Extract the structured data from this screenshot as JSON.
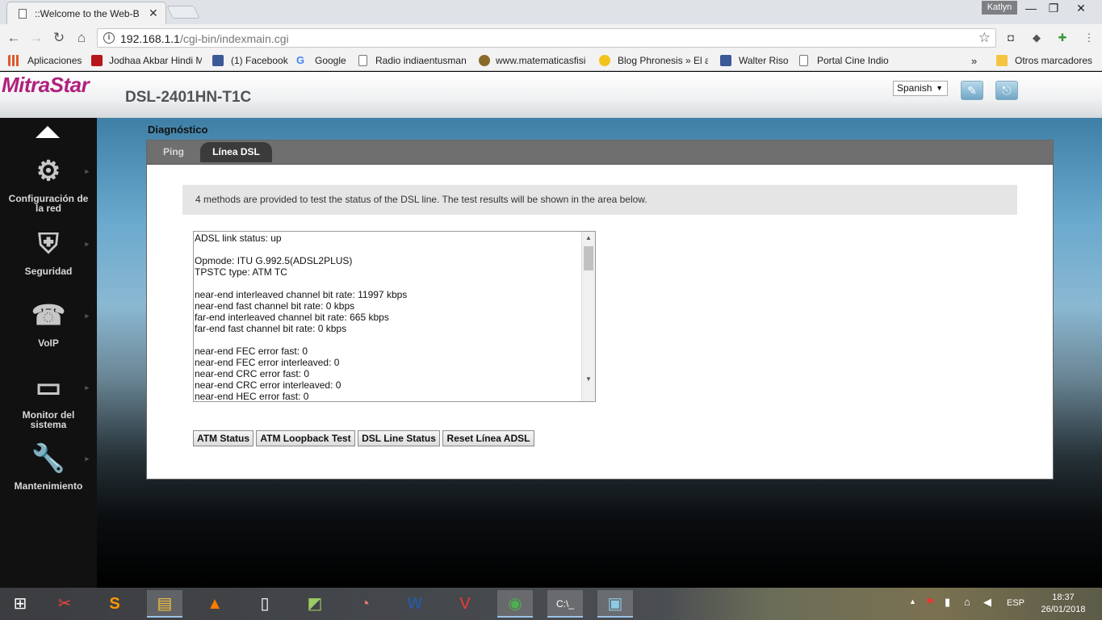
{
  "browser": {
    "tab_title": "::Welcome to the Web-B",
    "user": "Katlyn",
    "url_host": "192.168.1.1",
    "url_path": "/cgi-bin/indexmain.cgi",
    "bookmarks": [
      {
        "label": "Aplicaciones",
        "icon": "apps-grid-icon",
        "color": "#e05a2b"
      },
      {
        "label": "Jodhaa Akbar Hindi M",
        "icon": "site-icon",
        "color": "#b5171d"
      },
      {
        "label": "(1) Facebook",
        "icon": "facebook-icon",
        "color": "#3b5998"
      },
      {
        "label": "Google",
        "icon": "google-icon",
        "color": "#4285f4"
      },
      {
        "label": "Radio indiaentusmano",
        "icon": "page-icon",
        "color": "#ffffff"
      },
      {
        "label": "www.matematicasfisic",
        "icon": "site-icon",
        "color": "#8a6a2a"
      },
      {
        "label": "Blog Phronesis » El ar",
        "icon": "emoji-icon",
        "color": "#f3c21b"
      },
      {
        "label": "Walter Riso",
        "icon": "facebook-icon",
        "color": "#3b5998"
      },
      {
        "label": "Portal Cine Indio",
        "icon": "page-icon",
        "color": "#ffffff"
      }
    ],
    "bookmarks_more": "»",
    "other_bookmarks": "Otros marcadores"
  },
  "router": {
    "brand": "MitraStar",
    "model": "DSL-2401HN-T1C",
    "language": "Spanish",
    "brand_color": "#b0207d"
  },
  "sidebar": {
    "items": [
      {
        "label": "Configuración de la red",
        "icon": "gears-icon"
      },
      {
        "label": "Seguridad",
        "icon": "shield-firewall-icon"
      },
      {
        "label": "VoIP",
        "icon": "phone-icon"
      },
      {
        "label": "Monitor del sistema",
        "icon": "monitor-icon"
      },
      {
        "label": "Mantenimiento",
        "icon": "wrench-icon"
      }
    ]
  },
  "main": {
    "section_title": "Diagnóstico",
    "tabs": [
      "Ping",
      "Línea DSL"
    ],
    "info_text": "4 methods are provided to test the status of the DSL line. The test results will be shown in the area below.",
    "log_text": "ADSL link status: up\n\nOpmode: ITU G.992.5(ADSL2PLUS)\nTPSTC type: ATM TC\n\nnear-end interleaved channel bit rate: 11997 kbps\nnear-end fast channel bit rate: 0 kbps\nfar-end interleaved channel bit rate: 665 kbps\nfar-end fast channel bit rate: 0 kbps\n\nnear-end FEC error fast: 0\nnear-end FEC error interleaved: 0\nnear-end CRC error fast: 0\nnear-end CRC error interleaved: 0\nnear-end HEC error fast: 0",
    "buttons": [
      "ATM Status",
      "ATM Loopback Test",
      "DSL Line Status",
      "Reset Línea ADSL"
    ]
  },
  "taskbar": {
    "language": "ESP",
    "time": "18:37",
    "date": "26/01/2018"
  }
}
